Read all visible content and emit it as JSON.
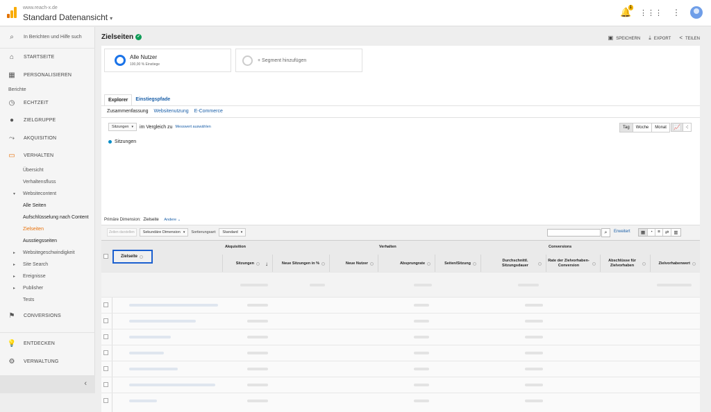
{
  "header": {
    "url": "www.reach-x.de",
    "view_name": "Standard Datenansicht",
    "view_caret": "▾",
    "notification_count": "1",
    "colors": {
      "logo_dark": "#e37400",
      "logo_light": "#f9ab00",
      "accent": "#1a73e8"
    }
  },
  "sidebar": {
    "search_placeholder": "In Berichten und Hilfe such",
    "items": [
      {
        "label": "STARTSEITE",
        "icon": "home-icon"
      },
      {
        "label": "PERSONALISIEREN",
        "icon": "dashboard-icon"
      }
    ],
    "reports_label": "Berichte",
    "report_items": [
      {
        "label": "ECHTZEIT",
        "icon": "clock-icon"
      },
      {
        "label": "ZIELGRUPPE",
        "icon": "person-icon"
      },
      {
        "label": "AKQUISITION",
        "icon": "acquisition-icon"
      },
      {
        "label": "VERHALTEN",
        "icon": "behavior-icon"
      }
    ],
    "behavior_sub": [
      "Übersicht",
      "Verhaltensfluss"
    ],
    "websitecontent": "Websitecontent",
    "websitecontent_sub": [
      "Alle Seiten",
      "Aufschlüsselung nach Content",
      "Zielseiten",
      "Ausstiegsseiten"
    ],
    "behavior_more": [
      "Websitegeschwindigkeit",
      "Site Search",
      "Ereignisse",
      "Publisher"
    ],
    "tests": "Tests",
    "conversions": "CONVERSIONS",
    "discover": "ENTDECKEN",
    "admin": "VERWALTUNG"
  },
  "main": {
    "page_title": "Zielseiten",
    "actions": {
      "save": "SPEICHERN",
      "export": "EXPORT",
      "share": "TEILEN"
    },
    "segment": {
      "name": "Alle Nutzer",
      "sub": "100,00 % Einstiege",
      "add": "+ Segment hinzufügen"
    },
    "tabs": [
      "Explorer",
      "Einstiegspfade"
    ],
    "subtabs": [
      "Zusammenfassung",
      "Websitenutzung",
      "E-Commerce"
    ],
    "metric_dropdown": "Sitzungen",
    "compare_text": "im Vergleich zu",
    "select_metric": "Messwert auswählen",
    "period": [
      "Tag",
      "Woche",
      "Monat"
    ],
    "legend": "Sitzungen",
    "primary_dimension_label": "Primäre Dimension:",
    "primary_dimension_value": "Zielseite",
    "primary_dimension_other": "Andere ⌄",
    "plot_rows": "Zeilen darstellen",
    "secondary_dimension": "Sekundäre Dimension",
    "sort_label": "Sortierungsart:",
    "sort_value": "Standard",
    "advanced": "Erweitert",
    "table": {
      "group_acquisition": "Akquisition",
      "group_behavior": "Verhalten",
      "group_conversions": "Conversions",
      "first_col": "Zielseite",
      "columns": [
        "Sitzungen",
        "Neue Sitzungen in %",
        "Neue Nutzer",
        "Absprungrate",
        "Seiten/Sitzung",
        "Durchschnittl. Sitzungsdauer",
        "Rate der Zielvorhaben-Conversion",
        "Abschlüsse für Zielvorhaben",
        "Zielvorhabenwert"
      ]
    }
  }
}
